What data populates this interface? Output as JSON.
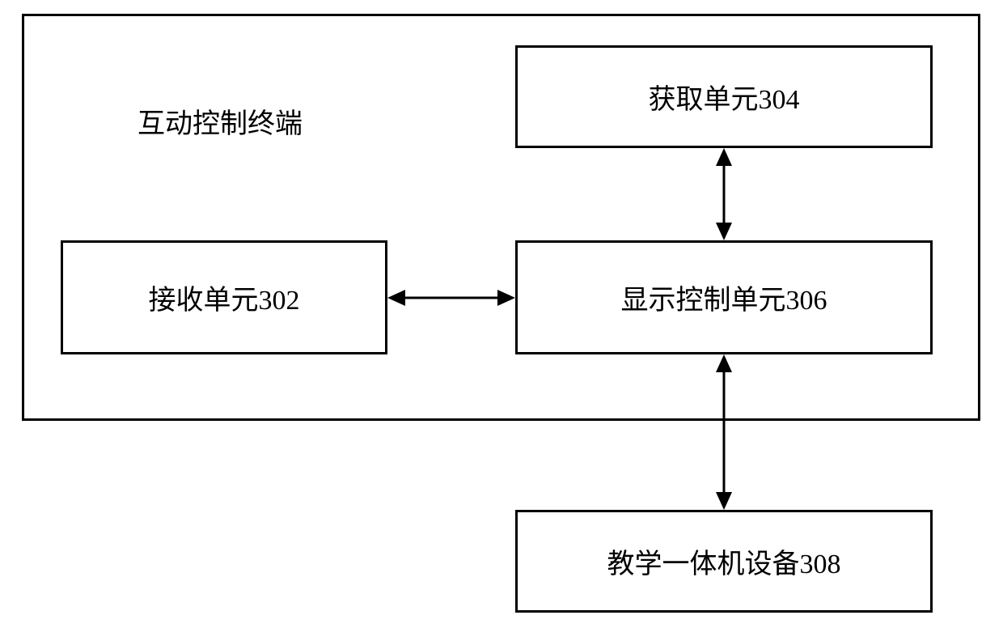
{
  "diagram": {
    "container_label": "互动控制终端",
    "box_304": "获取单元304",
    "box_302": "接收单元302",
    "box_306": "显示控制单元306",
    "box_308": "教学一体机设备308"
  }
}
